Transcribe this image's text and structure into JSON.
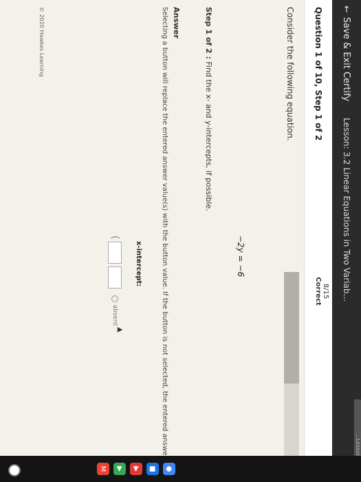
{
  "header": {
    "back_label": "Save & Exit Certify",
    "lesson_title": "Lesson: 3.2 Linear Equations in Two Variab...",
    "tab_strip_text": "...Lesson Certify..."
  },
  "question": {
    "title": "Question 1 of 10, Step 1 of 2",
    "score_value": "8/15",
    "score_label": "Correct",
    "progress": 0.53
  },
  "content": {
    "prompt": "Consider the following equation.",
    "equation": "−2y = −6",
    "step_label": "Step 1 of 2 :",
    "step_text": "Find the x- and y-intercepts, if possible.",
    "answer_heading": "Answer",
    "answer_instructions": "Selecting a button will replace the entered answer value(s) with the button value. If the button is not selected, the entered answer is used.",
    "x_intercept_label": "x-intercept:",
    "open_paren": "(",
    "absent_label": "absent",
    "copyright": "© 2020 Hawkes Learning"
  },
  "icons": {
    "back": "arrow-left-icon",
    "launcher": "launcher-icon",
    "chrome": "chrome-icon",
    "files": "files-icon",
    "youtube": "youtube-icon",
    "play": "play-store-icon",
    "gmail": "gmail-icon"
  }
}
